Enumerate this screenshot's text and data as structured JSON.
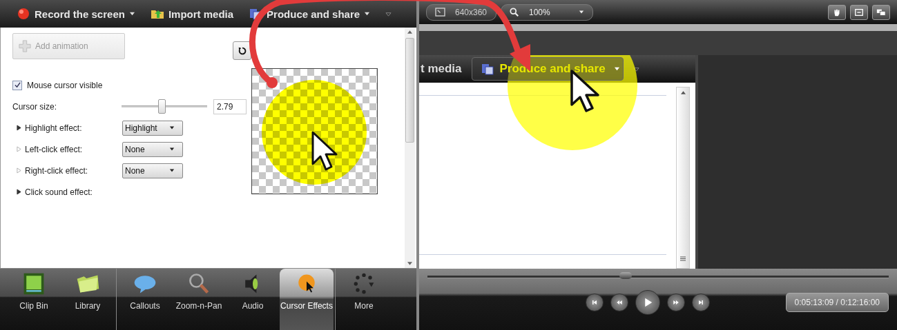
{
  "toolbar": [
    {
      "kind": "record",
      "label": "Record the screen",
      "dropdown": true
    },
    {
      "kind": "import",
      "label": "Import media",
      "dropdown": false
    },
    {
      "kind": "produce",
      "label": "Produce and share",
      "dropdown": true
    }
  ],
  "cursor_panel": {
    "add_animation": {
      "label": "Add animation",
      "disabled": true
    },
    "mouse_cursor_visible": {
      "label": "Mouse cursor visible",
      "checked": true
    },
    "cursor_size": {
      "label": "Cursor size:",
      "level": 0.46,
      "value": "2.79"
    },
    "effects": [
      {
        "label": "Highlight effect:",
        "disabled": false,
        "value": "Highlight"
      },
      {
        "label": "Left-click effect:",
        "disabled": true,
        "value": "None"
      },
      {
        "label": "Right-click effect:",
        "disabled": true,
        "value": "None"
      },
      {
        "label": "Click sound effect:",
        "disabled": false
      }
    ]
  },
  "tabs": [
    {
      "kind": "clipbin",
      "label": "Clip Bin",
      "selected": false,
      "separator_before": false
    },
    {
      "kind": "library",
      "label": "Library",
      "selected": false,
      "separator_before": false
    },
    {
      "kind": "callouts",
      "label": "Callouts",
      "selected": false,
      "separator_before": true
    },
    {
      "kind": "zoom",
      "label": "Zoom-n-Pan",
      "selected": false,
      "separator_before": false
    },
    {
      "kind": "audio",
      "label": "Audio",
      "selected": false,
      "separator_before": false
    },
    {
      "kind": "cursor",
      "label": "Cursor Effects",
      "selected": true,
      "separator_before": false
    },
    {
      "kind": "more",
      "label": "More",
      "selected": false,
      "separator_before": true
    }
  ],
  "preview_bar": {
    "dimensions": "640x360",
    "zoom": "100%"
  },
  "preview_toolbar": [
    {
      "kind": "text",
      "label": "t media"
    },
    {
      "kind": "button",
      "label": "Produce and share",
      "dropdown": true
    }
  ],
  "player": {
    "level": 0.43,
    "time": "0:05:13:09 / 0:12:16:00"
  }
}
